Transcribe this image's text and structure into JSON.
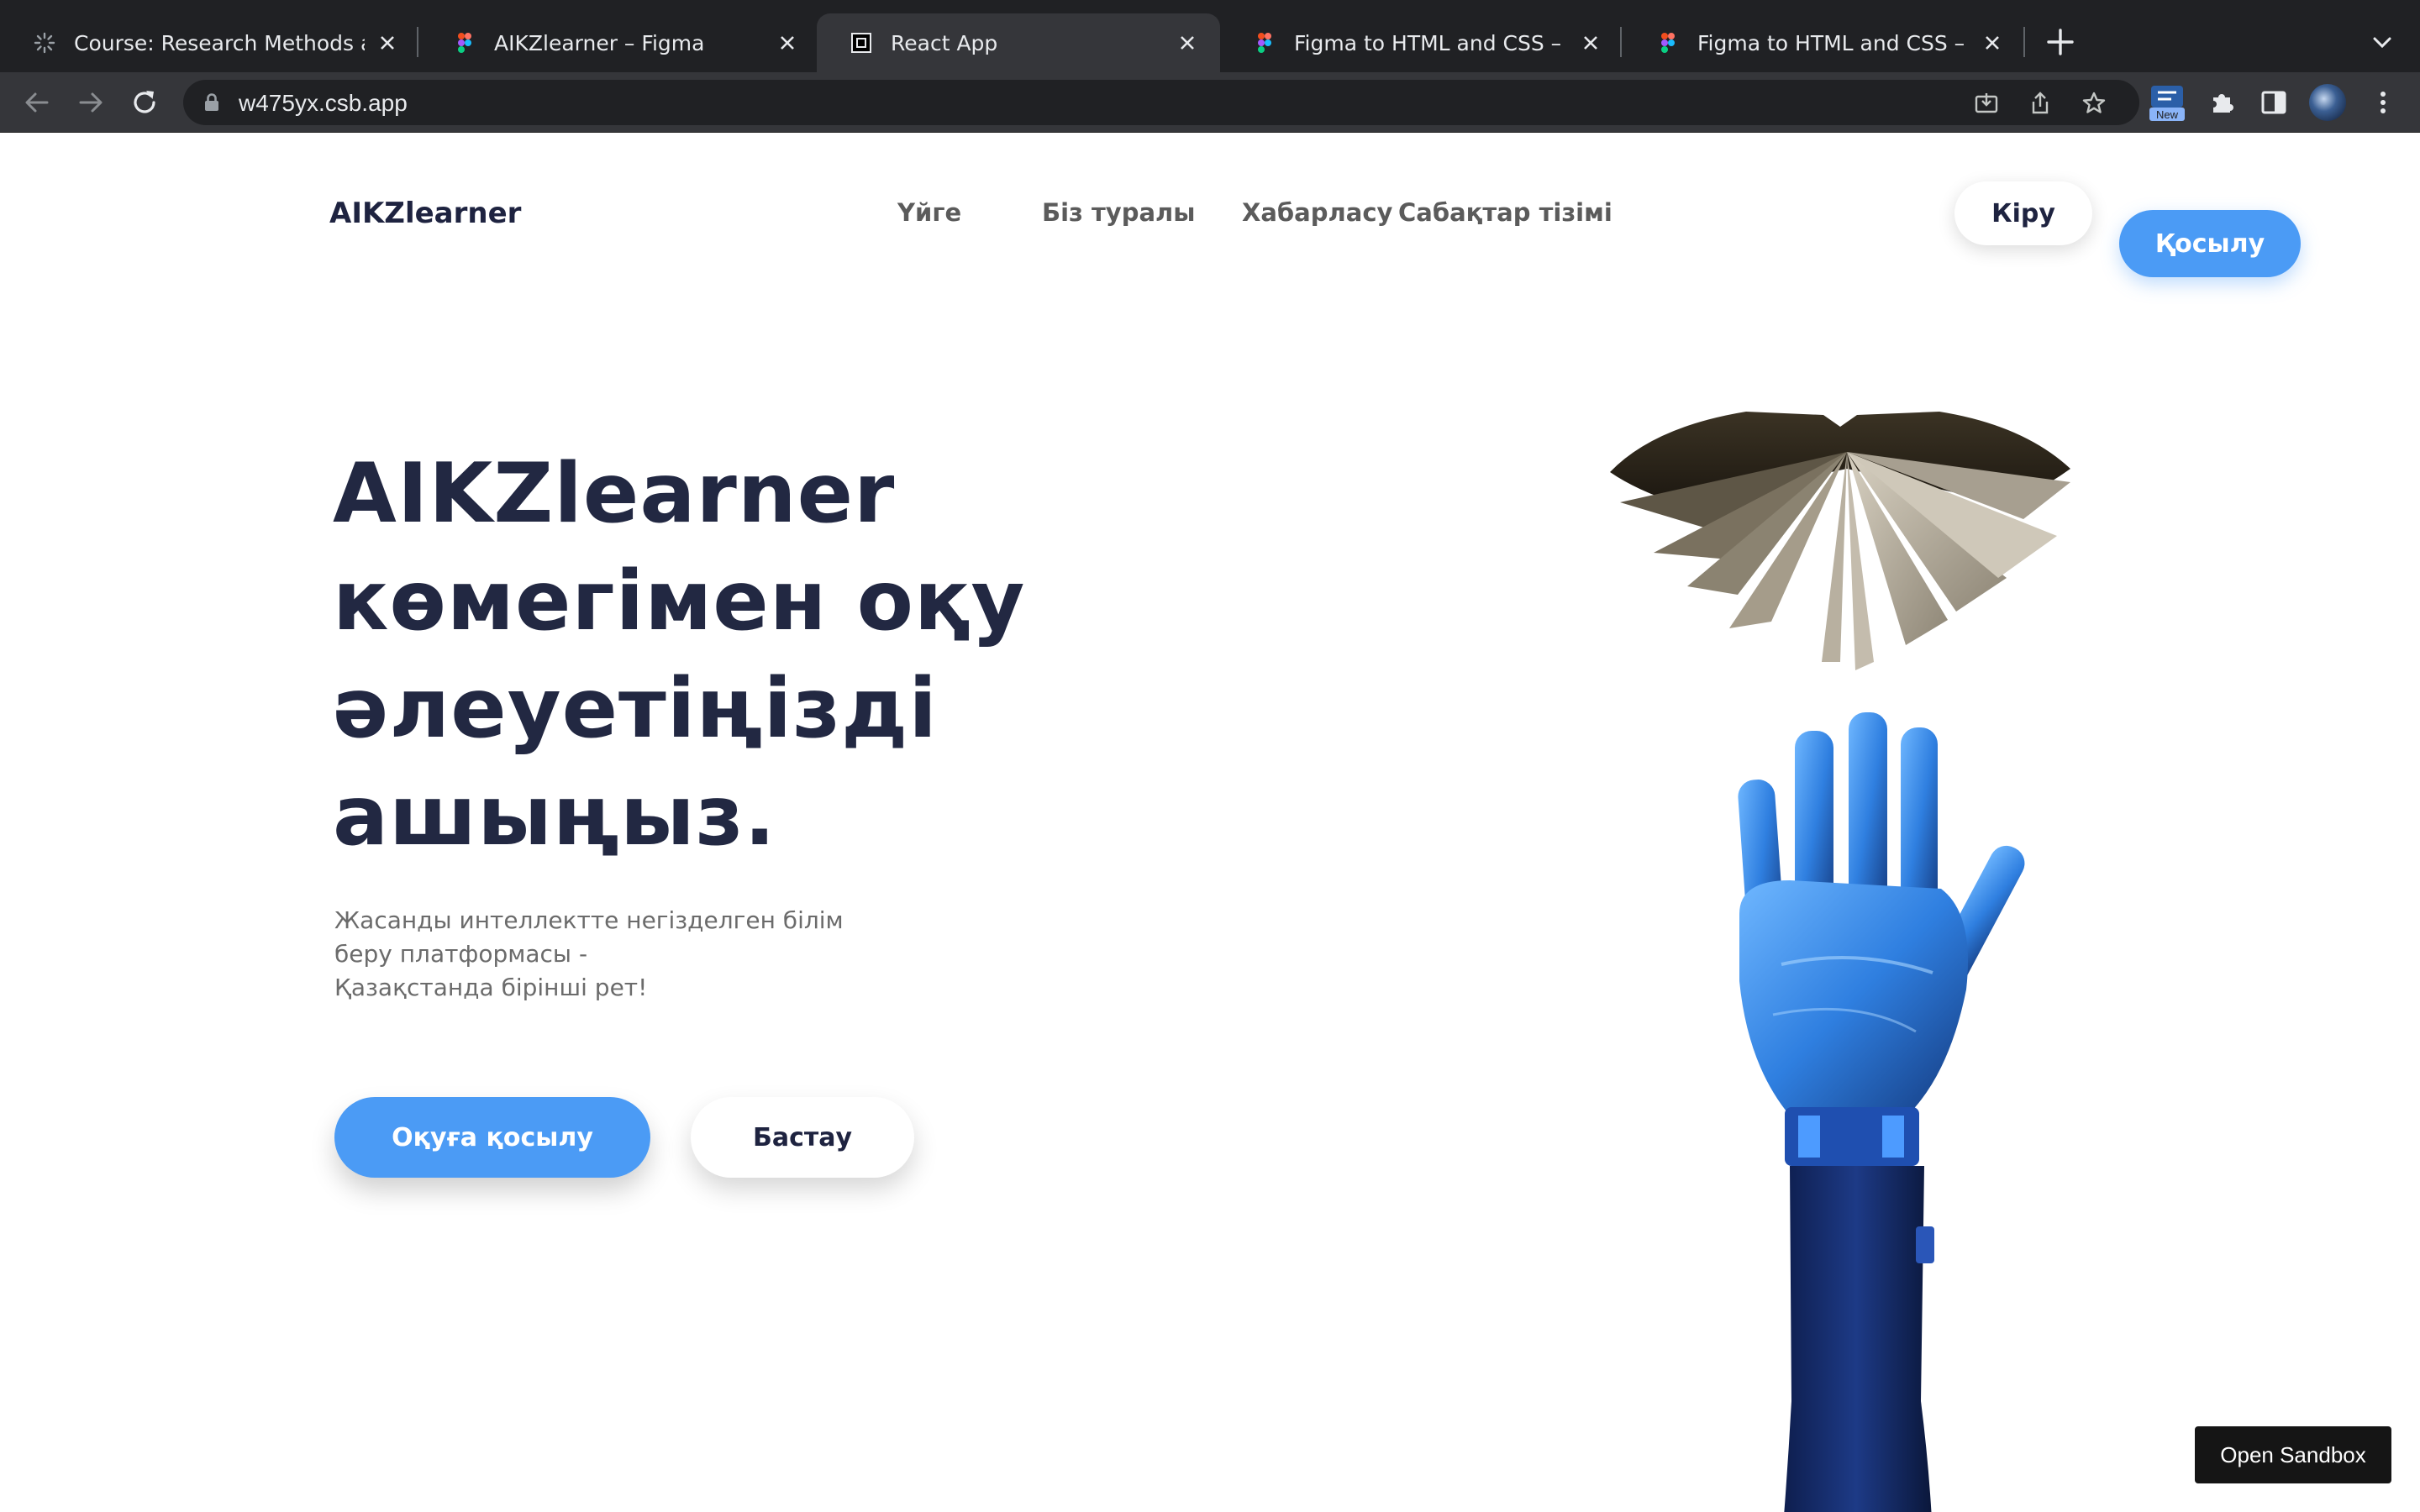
{
  "browser": {
    "tabs": [
      {
        "title": "Course: Research Methods and",
        "favicon": "spinner-icon",
        "active": false
      },
      {
        "title": "AIKZlearner – Figma",
        "favicon": "figma-icon",
        "active": false
      },
      {
        "title": "React App",
        "favicon": "codesandbox-icon",
        "active": true
      },
      {
        "title": "Figma to HTML and CSS – Figm",
        "favicon": "figma-icon",
        "active": false
      },
      {
        "title": "Figma to HTML and CSS – Figm",
        "favicon": "figma-icon",
        "active": false
      }
    ],
    "url": "w475yx.csb.app",
    "extension_badge": "New"
  },
  "site": {
    "brand": "AIKZlearner",
    "nav": [
      "Үйге",
      "Біз туралы",
      "Хабарласу",
      "Сабақтар тізімі"
    ],
    "login_label": "Кіру",
    "signup_label": "Қосылу"
  },
  "hero": {
    "title": "AIKZlearner көмегімен оқу әлеуетіңізді ашыңыз.",
    "subtitle": "Жасанды интеллектте негізделген білім\nберу платформасы -\nҚазақстанда бірінші рет!",
    "primary_cta": "Оқуға қосылу",
    "secondary_cta": "Бастау"
  },
  "sandbox": {
    "open_label": "Open Sandbox"
  },
  "colors": {
    "accent": "#4b9bf5",
    "title": "#222842",
    "chrome_bg": "#202124",
    "chrome_toolbar": "#35363a"
  }
}
